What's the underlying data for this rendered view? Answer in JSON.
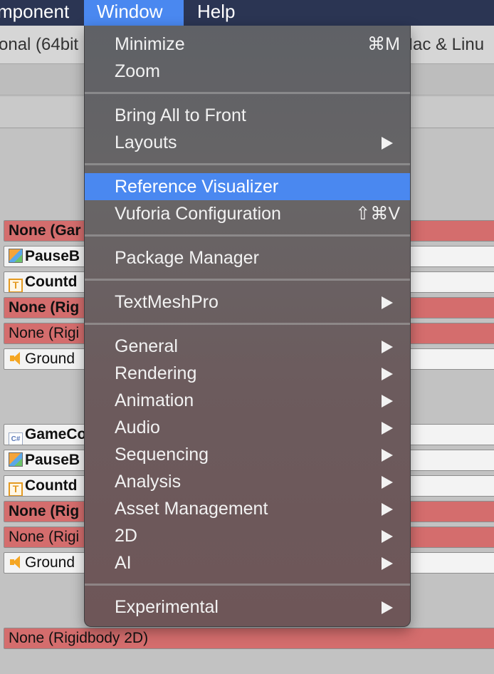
{
  "menubar": {
    "component": "mponent",
    "window": "Window",
    "help": "Help"
  },
  "toolbar": {
    "left_text": "onal (64bit",
    "right_text": "Mac & Linu"
  },
  "panel": {
    "fields": [
      {
        "text": "None (Gar",
        "style": "none",
        "bold": true,
        "icon": null
      },
      {
        "text": "PauseB",
        "style": "obj",
        "bold": true,
        "icon": "cube-icon"
      },
      {
        "text": "Countd",
        "style": "obj",
        "bold": true,
        "icon": "text-icon"
      },
      {
        "text": "None (Rig",
        "style": "none",
        "bold": true,
        "icon": null
      },
      {
        "text": "None (Rigi",
        "style": "none",
        "bold": false,
        "icon": null
      },
      {
        "text": "Ground",
        "style": "obj",
        "bold": false,
        "icon": "speaker-icon"
      },
      {
        "text": "GameCo",
        "style": "obj",
        "bold": true,
        "icon": "script-icon"
      },
      {
        "text": "PauseB",
        "style": "obj",
        "bold": true,
        "icon": "cube-icon"
      },
      {
        "text": "Countd",
        "style": "obj",
        "bold": true,
        "icon": "text-icon"
      },
      {
        "text": "None (Rig",
        "style": "none",
        "bold": true,
        "icon": null
      },
      {
        "text": "None (Rigi",
        "style": "none",
        "bold": false,
        "icon": null
      },
      {
        "text": "Ground",
        "style": "obj",
        "bold": false,
        "icon": "speaker-icon"
      },
      {
        "text": "None (Rigidbody 2D)",
        "style": "none",
        "bold": false,
        "icon": null
      }
    ],
    "icon_glyphs": {
      "text-icon": "T",
      "script-icon": "C#"
    }
  },
  "window_menu": {
    "items": [
      {
        "label": "Minimize",
        "shortcut": "⌘M"
      },
      {
        "label": "Zoom"
      },
      {
        "label": "Bring All to Front"
      },
      {
        "label": "Layouts",
        "submenu": true
      },
      {
        "label": "Reference Visualizer",
        "highlighted": true
      },
      {
        "label": "Vuforia Configuration",
        "shortcut": "⇧⌘V"
      },
      {
        "label": "Package Manager"
      },
      {
        "label": "TextMeshPro",
        "submenu": true
      },
      {
        "label": "General",
        "submenu": true
      },
      {
        "label": "Rendering",
        "submenu": true
      },
      {
        "label": "Animation",
        "submenu": true
      },
      {
        "label": "Audio",
        "submenu": true
      },
      {
        "label": "Sequencing",
        "submenu": true
      },
      {
        "label": "Analysis",
        "submenu": true
      },
      {
        "label": "Asset Management",
        "submenu": true
      },
      {
        "label": "2D",
        "submenu": true
      },
      {
        "label": "AI",
        "submenu": true
      },
      {
        "label": "Experimental",
        "submenu": true
      }
    ]
  },
  "colors": {
    "menubar_bg": "#2b3553",
    "highlight": "#4a88f0",
    "none_field": "#d46d6d",
    "panel_bg": "#c2c2c2"
  }
}
